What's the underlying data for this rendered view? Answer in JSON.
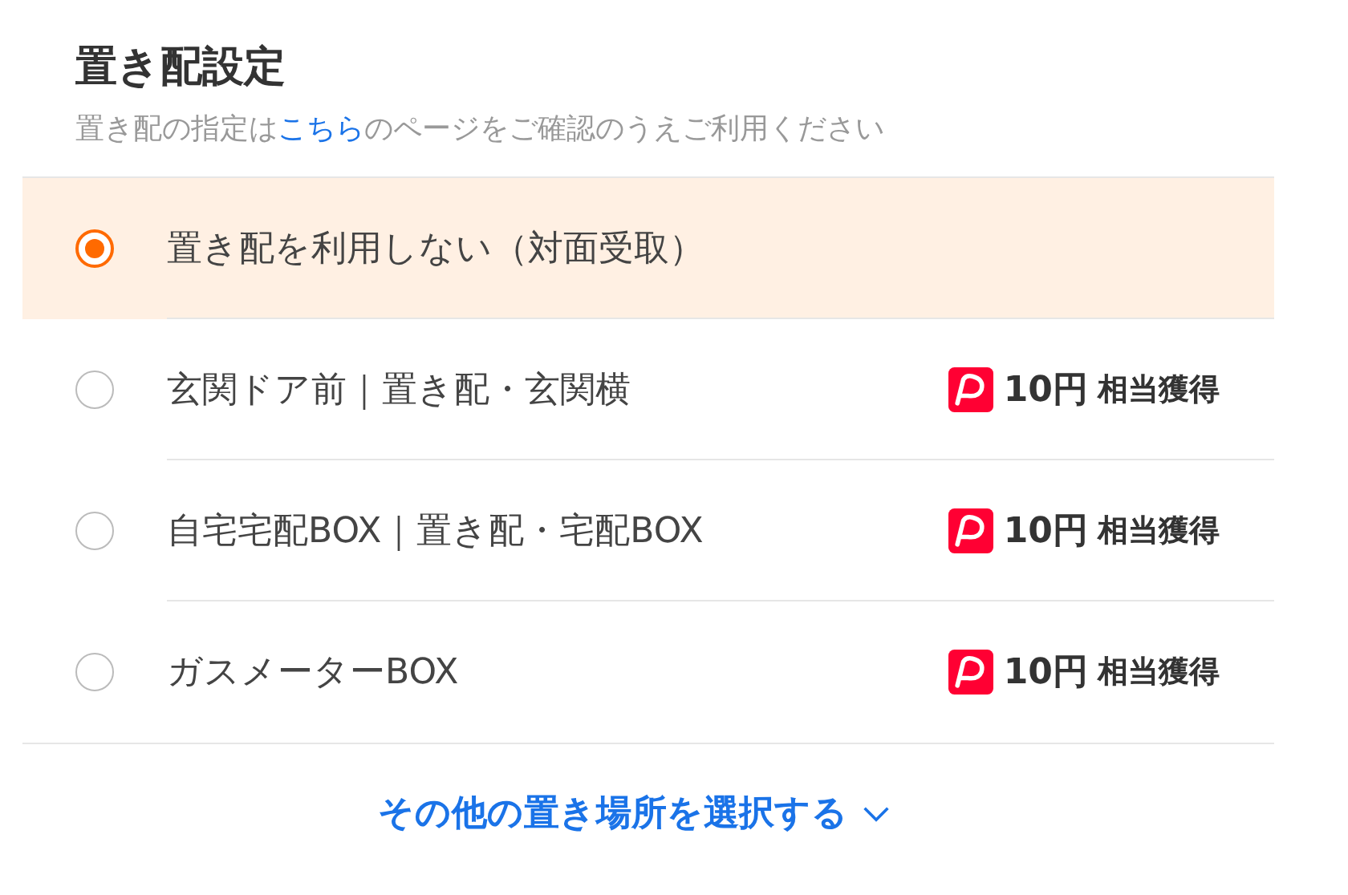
{
  "title": "置き配設定",
  "subtitle": {
    "before": "置き配の指定は",
    "link": "こちら",
    "after": "のページをご確認のうえご利用ください"
  },
  "options": [
    {
      "label": "置き配を利用しない（対面受取）",
      "selected": true
    },
    {
      "label": "玄関ドア前｜置き配・玄関横",
      "selected": false,
      "points": {
        "amount": "10円",
        "suffix": "相当獲得"
      }
    },
    {
      "label": "自宅宅配BOX｜置き配・宅配BOX",
      "selected": false,
      "points": {
        "amount": "10円",
        "suffix": "相当獲得"
      }
    },
    {
      "label": "ガスメーターBOX",
      "selected": false,
      "points": {
        "amount": "10円",
        "suffix": "相当獲得"
      }
    }
  ],
  "more_link": "その他の置き場所を選択する"
}
